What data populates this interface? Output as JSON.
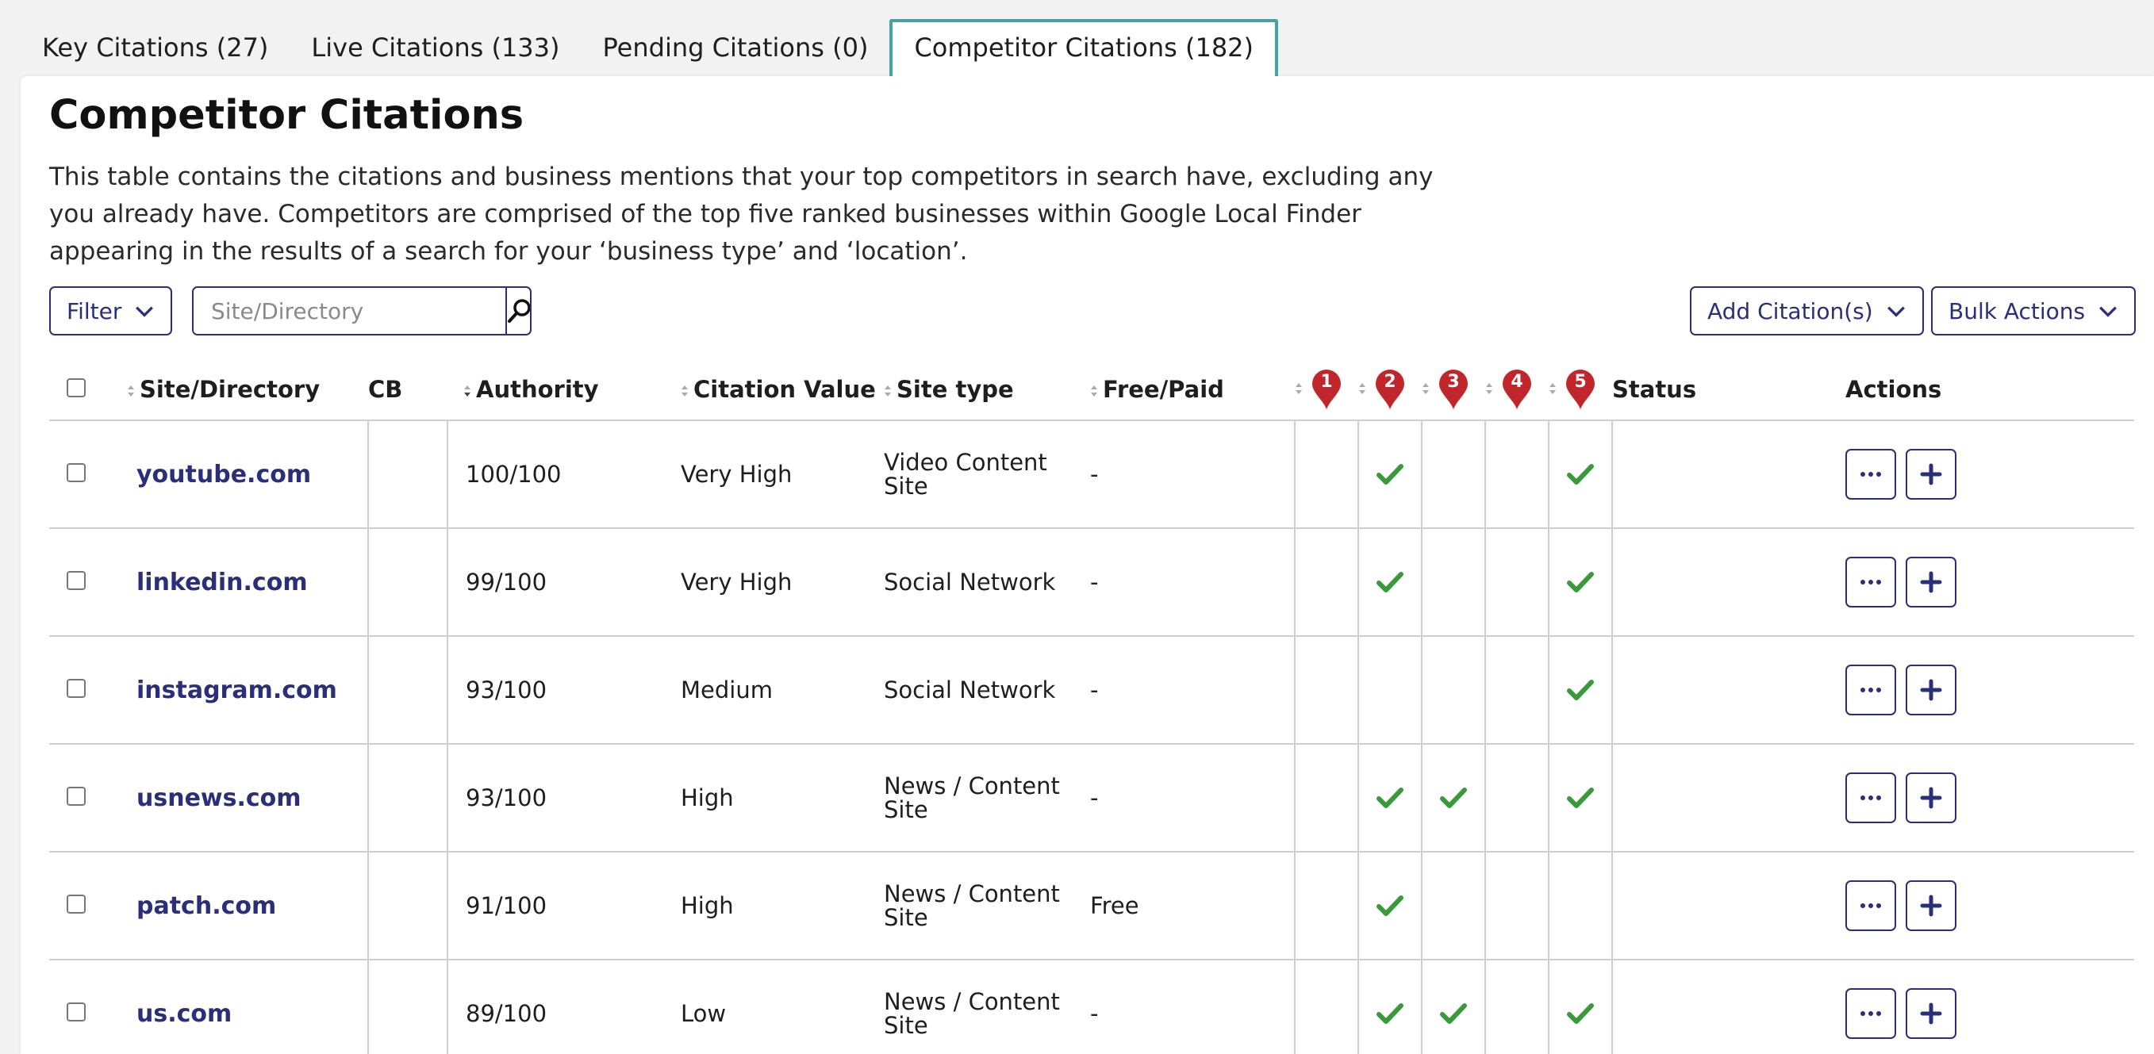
{
  "tabs": [
    {
      "label": "Key Citations (27)"
    },
    {
      "label": "Live Citations (133)"
    },
    {
      "label": "Pending Citations (0)"
    },
    {
      "label": "Competitor Citations (182)",
      "active": true
    }
  ],
  "page": {
    "title": "Competitor Citations",
    "description": "This table contains the citations and business mentions that your top competitors in search have, excluding any you already have. Competitors are comprised of the top five ranked businesses within Google Local Finder appearing in the results of a search for your ‘business type’ and ‘location’."
  },
  "toolbar": {
    "filter_label": "Filter",
    "search_placeholder": "Site/Directory",
    "add_label": "Add Citation(s)",
    "bulk_label": "Bulk Actions"
  },
  "columns": {
    "site": "Site/Directory",
    "cb": "CB",
    "authority": "Authority",
    "value": "Citation Value",
    "type": "Site type",
    "free": "Free/Paid",
    "competitors": [
      "1",
      "2",
      "3",
      "4",
      "5"
    ],
    "status": "Status",
    "actions": "Actions"
  },
  "rows": [
    {
      "site": "youtube.com",
      "authority": "100/100",
      "value": "Very High",
      "type": "Video Content Site",
      "free": "-",
      "c": [
        false,
        true,
        false,
        false,
        true
      ]
    },
    {
      "site": "linkedin.com",
      "authority": "99/100",
      "value": "Very High",
      "type": "Social Network",
      "free": "-",
      "c": [
        false,
        true,
        false,
        false,
        true
      ]
    },
    {
      "site": "instagram.com",
      "authority": "93/100",
      "value": "Medium",
      "type": "Social Network",
      "free": "-",
      "c": [
        false,
        false,
        false,
        false,
        true
      ]
    },
    {
      "site": "usnews.com",
      "authority": "93/100",
      "value": "High",
      "type": "News / Content Site",
      "free": "-",
      "c": [
        false,
        true,
        true,
        false,
        true
      ]
    },
    {
      "site": "patch.com",
      "authority": "91/100",
      "value": "High",
      "type": "News / Content Site",
      "free": "Free",
      "c": [
        false,
        true,
        false,
        false,
        false
      ]
    },
    {
      "site": "us.com",
      "authority": "89/100",
      "value": "Low",
      "type": "News / Content Site",
      "free": "-",
      "c": [
        false,
        true,
        true,
        false,
        true
      ]
    }
  ],
  "colors": {
    "accent": "#2b2f7a",
    "tab_border": "#47a3a3",
    "pin": "#c0262c",
    "check": "#3a9a3a"
  }
}
